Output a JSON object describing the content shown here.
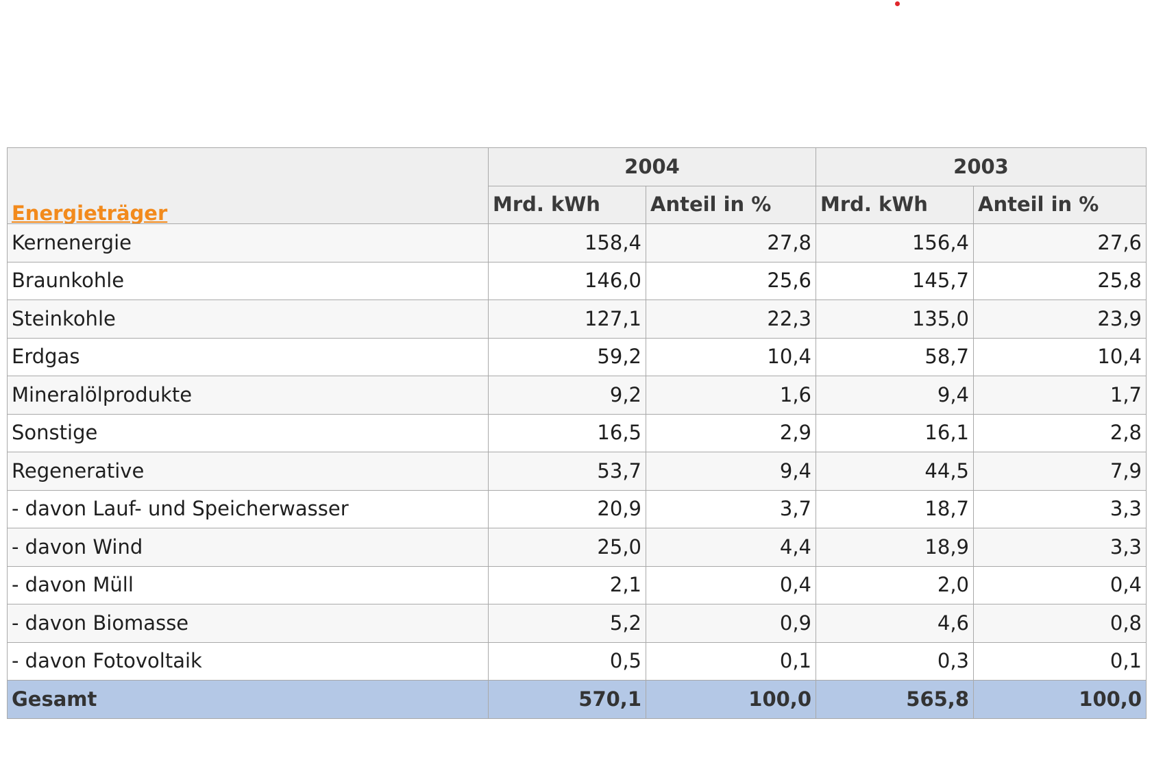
{
  "table": {
    "header": {
      "column_label": "Energieträger",
      "years": [
        "2004",
        "2003"
      ],
      "sub_headers": [
        "Mrd. kWh",
        "Anteil in %",
        "Mrd. kWh",
        "Anteil in %"
      ]
    },
    "rows": [
      {
        "label": "Kernenergie",
        "v2004": "158,4",
        "p2004": "27,8",
        "v2003": "156,4",
        "p2003": "27,6"
      },
      {
        "label": "Braunkohle",
        "v2004": "146,0",
        "p2004": "25,6",
        "v2003": "145,7",
        "p2003": "25,8"
      },
      {
        "label": "Steinkohle",
        "v2004": "127,1",
        "p2004": "22,3",
        "v2003": "135,0",
        "p2003": "23,9"
      },
      {
        "label": "Erdgas",
        "v2004": "59,2",
        "p2004": "10,4",
        "v2003": "58,7",
        "p2003": "10,4"
      },
      {
        "label": "Mineralölprodukte",
        "v2004": "9,2",
        "p2004": "1,6",
        "v2003": "9,4",
        "p2003": "1,7"
      },
      {
        "label": "Sonstige",
        "v2004": "16,5",
        "p2004": "2,9",
        "v2003": "16,1",
        "p2003": "2,8"
      },
      {
        "label": "Regenerative",
        "v2004": "53,7",
        "p2004": "9,4",
        "v2003": "44,5",
        "p2003": "7,9"
      },
      {
        "label": "- davon Lauf- und Speicherwasser",
        "v2004": "20,9",
        "p2004": "3,7",
        "v2003": "18,7",
        "p2003": "3,3"
      },
      {
        "label": "- davon Wind",
        "v2004": "25,0",
        "p2004": "4,4",
        "v2003": "18,9",
        "p2003": "3,3"
      },
      {
        "label": "- davon Müll",
        "v2004": "2,1",
        "p2004": "0,4",
        "v2003": "2,0",
        "p2003": "0,4"
      },
      {
        "label": "- davon Biomasse",
        "v2004": "5,2",
        "p2004": "0,9",
        "v2003": "4,6",
        "p2003": "0,8"
      },
      {
        "label": "- davon Fotovoltaik",
        "v2004": "0,5",
        "p2004": "0,1",
        "v2003": "0,3",
        "p2003": "0,1"
      }
    ],
    "total": {
      "label": "Gesamt",
      "v2004": "570,1",
      "p2004": "100,0",
      "v2003": "565,8",
      "p2003": "100,0"
    }
  },
  "colors": {
    "header_bg": "#efefef",
    "link_orange": "#f28a1c",
    "total_row_bg": "#b4c8e6",
    "border": "#a9a9a9",
    "accent_dot": "#e0262b"
  }
}
